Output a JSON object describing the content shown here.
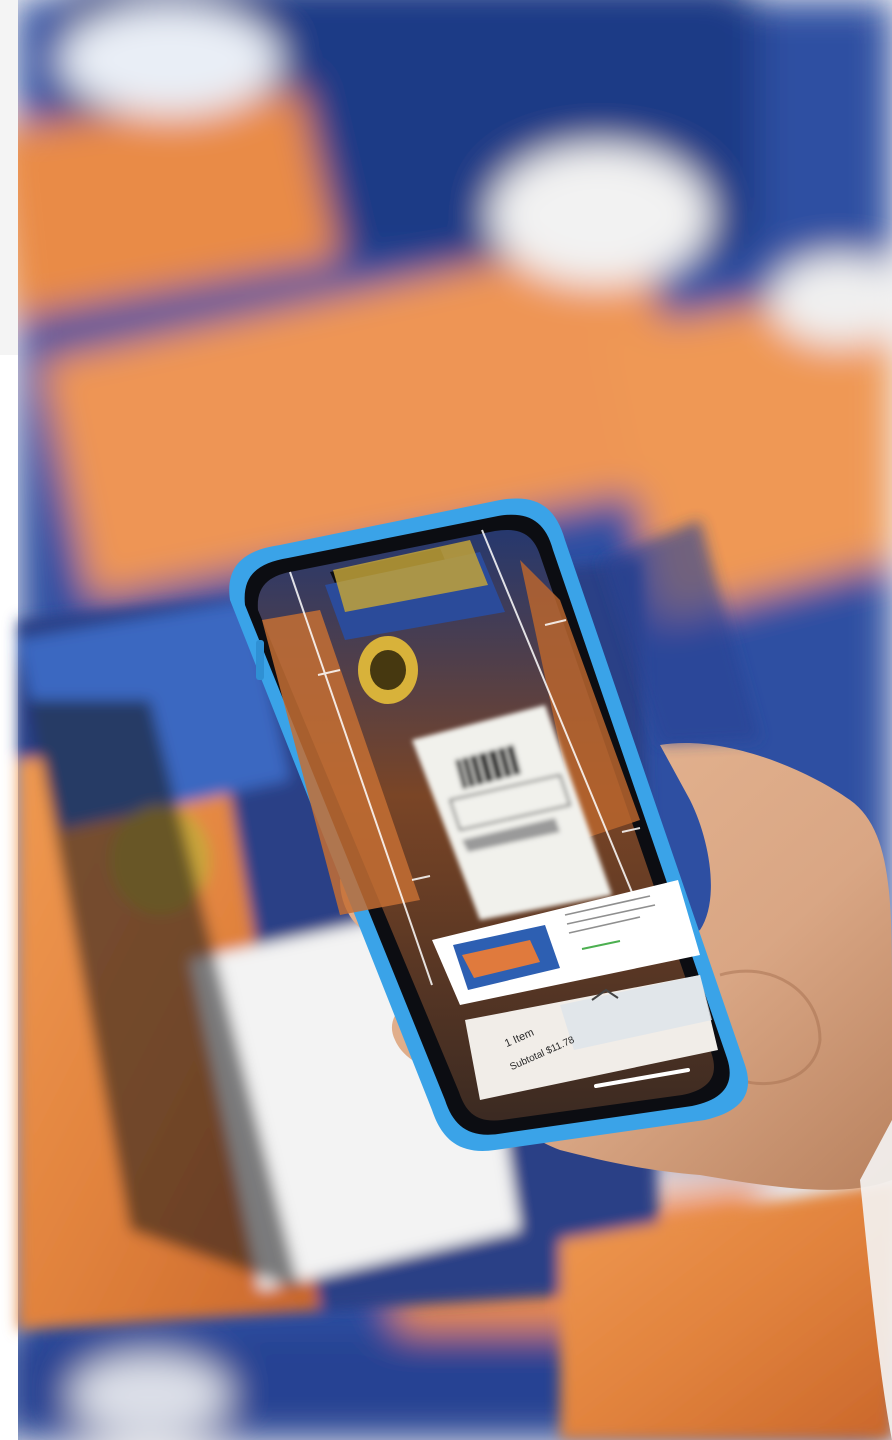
{
  "scene": {
    "kind": "photograph",
    "subject_icon": "hand-holding-smartphone-icon",
    "palette": {
      "background_light": "#f4f4f4",
      "blurred_blue": "#2f4fa2",
      "salmon": "#e0813c",
      "phone_case_blue": "#3aa3e8",
      "skin": "#d9a684"
    }
  },
  "phone_screen": {
    "cart_line": "1 Item",
    "subtotal_line": "Subtotal $11.78"
  }
}
